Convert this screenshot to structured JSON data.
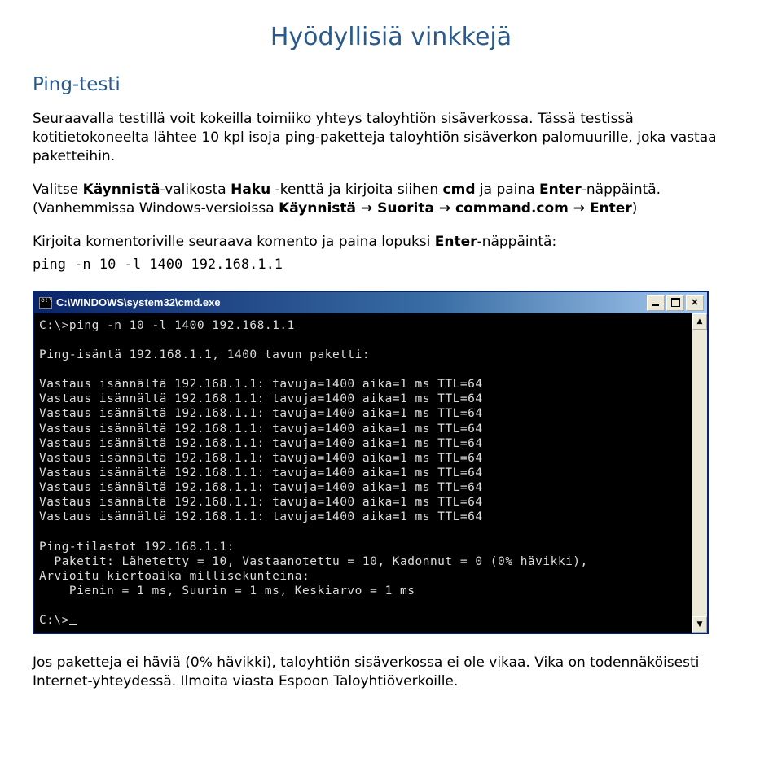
{
  "title": "Hyödyllisiä vinkkejä",
  "subtitle": "Ping-testi",
  "p1": "Seuraavalla testillä voit kokeilla toimiiko yhteys taloyhtiön sisäverkossa. Tässä testissä kotitietokoneelta lähtee 10 kpl isoja ping-paketteja taloyhtiön sisäverkon palomuurille, joka vastaa paketteihin.",
  "p2a": "Valitse ",
  "p2b": "Käynnistä",
  "p2c": "-valikosta ",
  "p2d": "Haku",
  "p2e": " -kenttä ja kirjoita siihen ",
  "p2f": "cmd",
  "p2g": " ja paina ",
  "p2h": "Enter",
  "p2i": "-näppäintä. (Vanhemmissa Windows-versioissa ",
  "p2j": "Käynnistä → Suorita → command.com → Enter",
  "p2k": ")",
  "p3a": "Kirjoita komentoriville seuraava komento ja paina lopuksi ",
  "p3b": "Enter",
  "p3c": "-näppäintä:",
  "cmd_example": "ping -n 10 -l 1400 192.168.1.1",
  "window": {
    "icon_text": "c:\\",
    "caption": "C:\\WINDOWS\\system32\\cmd.exe"
  },
  "console": {
    "line1": "C:\\>ping -n 10 -l 1400 192.168.1.1",
    "line2": "Ping-isäntä 192.168.1.1, 1400 tavun paketti:",
    "replies": [
      "Vastaus isännältä 192.168.1.1: tavuja=1400 aika=1 ms TTL=64",
      "Vastaus isännältä 192.168.1.1: tavuja=1400 aika=1 ms TTL=64",
      "Vastaus isännältä 192.168.1.1: tavuja=1400 aika=1 ms TTL=64",
      "Vastaus isännältä 192.168.1.1: tavuja=1400 aika=1 ms TTL=64",
      "Vastaus isännältä 192.168.1.1: tavuja=1400 aika=1 ms TTL=64",
      "Vastaus isännältä 192.168.1.1: tavuja=1400 aika=1 ms TTL=64",
      "Vastaus isännältä 192.168.1.1: tavuja=1400 aika=1 ms TTL=64",
      "Vastaus isännältä 192.168.1.1: tavuja=1400 aika=1 ms TTL=64",
      "Vastaus isännältä 192.168.1.1: tavuja=1400 aika=1 ms TTL=64",
      "Vastaus isännältä 192.168.1.1: tavuja=1400 aika=1 ms TTL=64"
    ],
    "stats_header": "Ping-tilastot 192.168.1.1:",
    "stats_packets": "  Paketit: Lähetetty = 10, Vastaanotettu = 10, Kadonnut = 0 (0% hävikki),",
    "stats_time_header": "Arvioitu kiertoaika millisekunteina:",
    "stats_time": "    Pienin = 1 ms, Suurin = 1 ms, Keskiarvo = 1 ms",
    "prompt_end": "C:\\>"
  },
  "footer": "Jos paketteja ei häviä (0% hävikki), taloyhtiön sisäverkossa ei ole vikaa. Vika on todennäköisesti Internet-yhteydessä. Ilmoita viasta Espoon Taloyhtiöverkoille."
}
